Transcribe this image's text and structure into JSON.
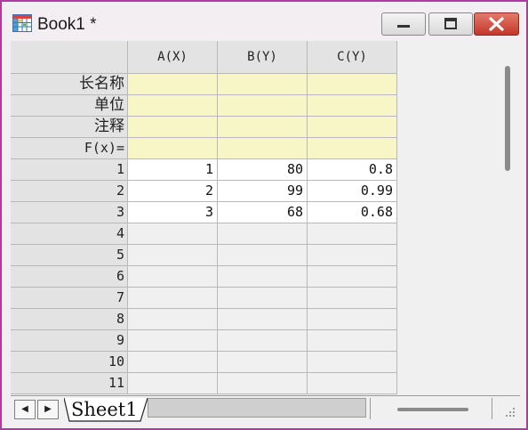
{
  "window": {
    "title": "Book1 *",
    "accent_color": "#b23a9a"
  },
  "columns": [
    {
      "label": "A(X)"
    },
    {
      "label": "B(Y)"
    },
    {
      "label": "C(Y)"
    }
  ],
  "meta_rows": [
    {
      "label": "长名称"
    },
    {
      "label": "单位"
    },
    {
      "label": "注释"
    },
    {
      "label": "F(x)="
    }
  ],
  "rows": [
    {
      "label": "1",
      "values": [
        "1",
        "80",
        "0.8"
      ]
    },
    {
      "label": "2",
      "values": [
        "2",
        "99",
        "0.99"
      ]
    },
    {
      "label": "3",
      "values": [
        "3",
        "68",
        "0.68"
      ]
    },
    {
      "label": "4",
      "values": [
        "",
        "",
        ""
      ]
    },
    {
      "label": "5",
      "values": [
        "",
        "",
        ""
      ]
    },
    {
      "label": "6",
      "values": [
        "",
        "",
        ""
      ]
    },
    {
      "label": "7",
      "values": [
        "",
        "",
        ""
      ]
    },
    {
      "label": "8",
      "values": [
        "",
        "",
        ""
      ]
    },
    {
      "label": "9",
      "values": [
        "",
        "",
        ""
      ]
    },
    {
      "label": "10",
      "values": [
        "",
        "",
        ""
      ]
    },
    {
      "label": "11",
      "values": [
        "",
        "",
        ""
      ]
    }
  ],
  "sheets": [
    {
      "label": "Sheet1"
    }
  ],
  "icons": {
    "app": "worksheet-icon",
    "minimize": "minimize-icon",
    "maximize": "maximize-icon",
    "close": "close-icon",
    "prev": "triangle-left-icon",
    "next": "triangle-right-icon",
    "grip": "resize-grip-icon"
  }
}
